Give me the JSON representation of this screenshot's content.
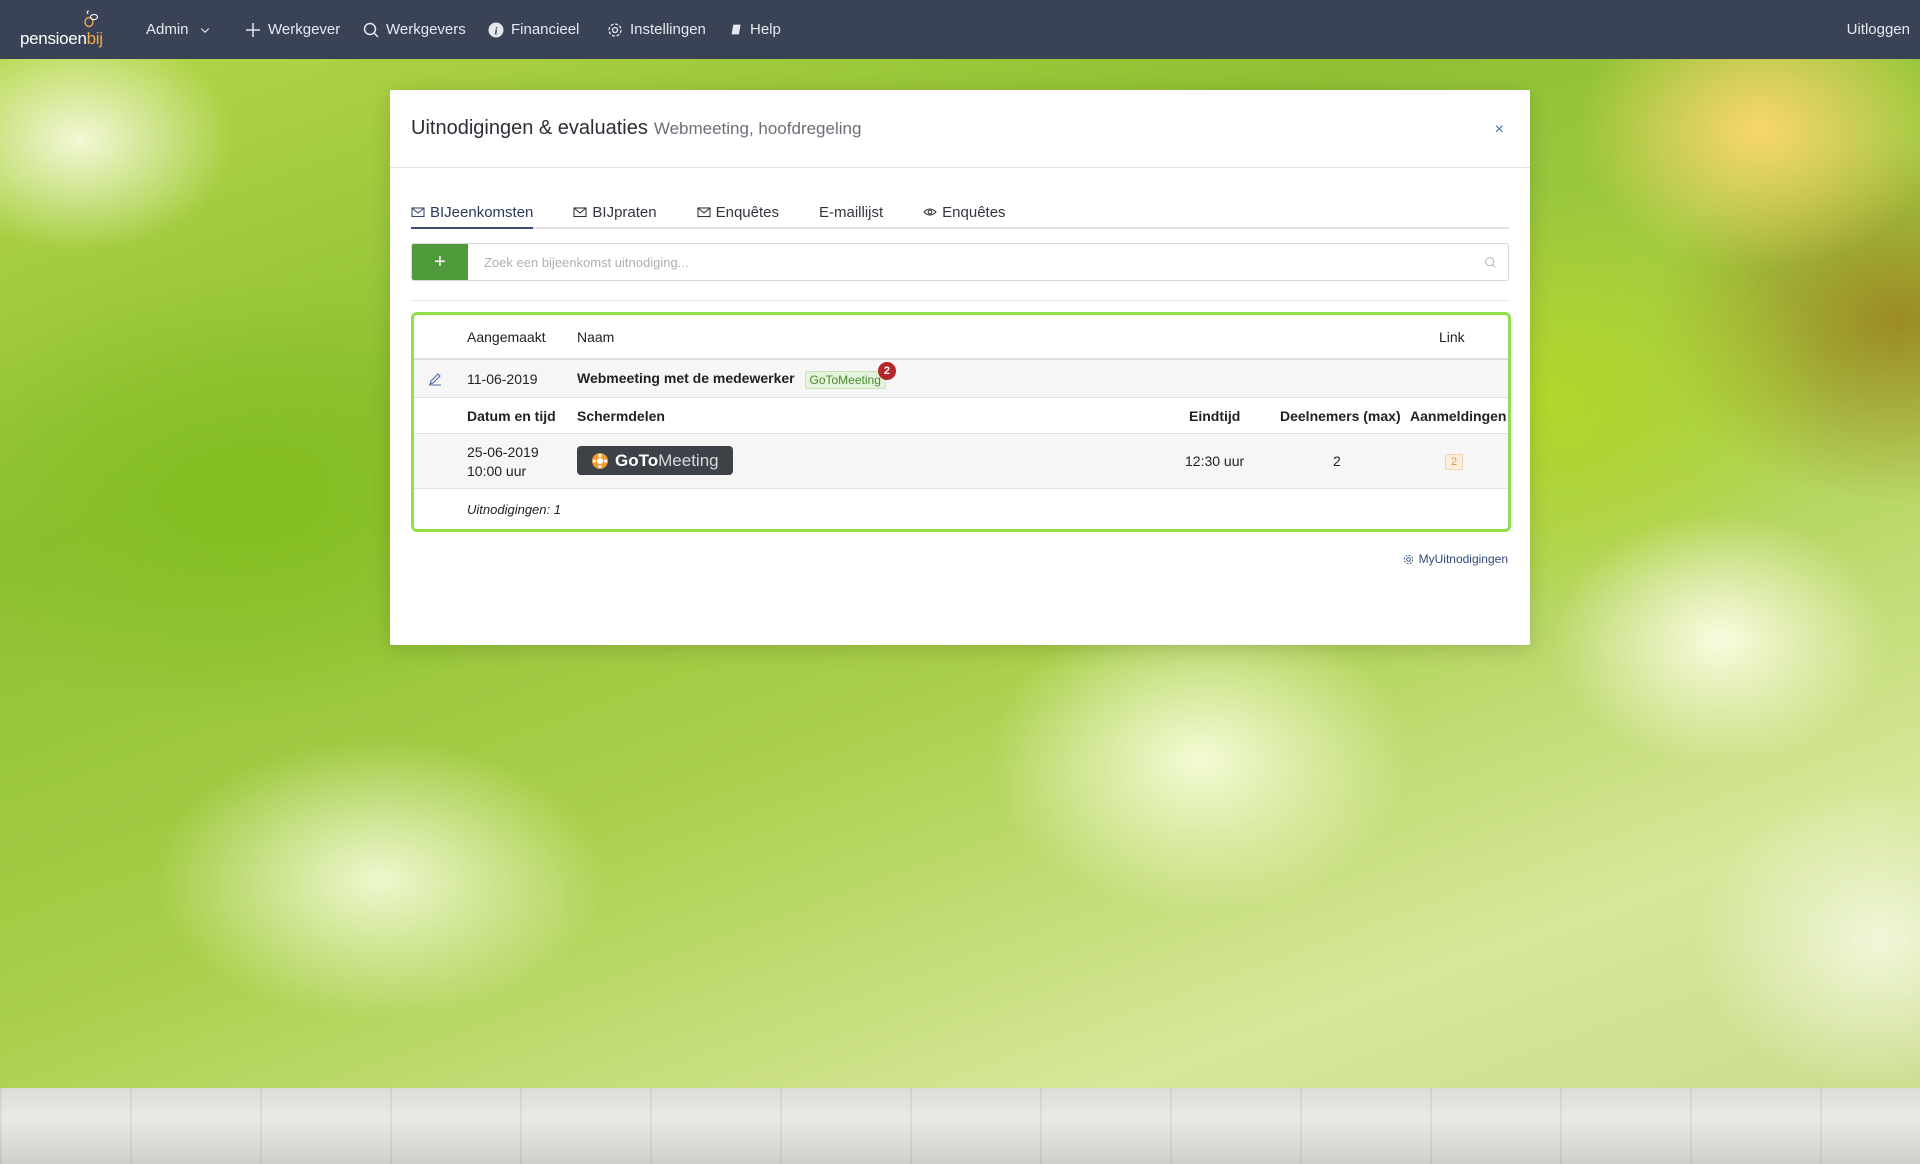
{
  "nav": {
    "logo_text": "pensioen",
    "logo_accent": "bij",
    "admin_label": "Admin",
    "items": [
      {
        "label": "Werkgever",
        "icon": "plus-icon"
      },
      {
        "label": "Werkgevers",
        "icon": "search-icon"
      },
      {
        "label": "Financieel",
        "icon": "info-icon"
      },
      {
        "label": "Instellingen",
        "icon": "gear-icon"
      },
      {
        "label": "Help",
        "icon": "book-icon"
      }
    ],
    "logout_label": "Uitloggen"
  },
  "modal": {
    "title": "Uitnodigingen & evaluaties",
    "subtitle": "Webmeeting, hoofdregeling",
    "close": "×",
    "tabs": [
      {
        "label": "BIJeenkomsten",
        "icon": "envelope-icon",
        "active": true
      },
      {
        "label": "BIJpraten",
        "icon": "envelope-icon",
        "active": false
      },
      {
        "label": "Enquêtes",
        "icon": "envelope-icon",
        "active": false
      },
      {
        "label": "E-maillijst",
        "icon": "",
        "active": false
      },
      {
        "label": "Enquêtes",
        "icon": "eye-icon",
        "active": false
      }
    ],
    "add_label": "+",
    "search_placeholder": "Zoek een bijeenkomst uitnodiging...",
    "table": {
      "headers": {
        "aangemaakt": "Aangemaakt",
        "naam": "Naam",
        "link": "Link"
      },
      "invite": {
        "date": "11-06-2019",
        "name": "Webmeeting met de medewerker",
        "tag": "GoToMeeting",
        "badge_count": "2"
      },
      "sub_headers": {
        "datum": "Datum en tijd",
        "schermdelen": "Schermdelen",
        "eindtijd": "Eindtijd",
        "deelnemers": "Deelnemers (max)",
        "aanmeldingen": "Aanmeldingen"
      },
      "session": {
        "date": "25-06-2019",
        "time": "10:00 uur",
        "logo_bold": "GoTo",
        "logo_light": "Meeting",
        "eindtijd": "12:30 uur",
        "deelnemers": "2",
        "aanmeldingen": "2"
      },
      "footer": "Uitnodigingen: 1"
    },
    "footer_link": "MyUitnodigingen"
  },
  "colors": {
    "navbar": "#3a4355",
    "accent_green": "#4f9a3a",
    "panel_border": "#8fe04a",
    "badge_red": "#b3262a"
  }
}
